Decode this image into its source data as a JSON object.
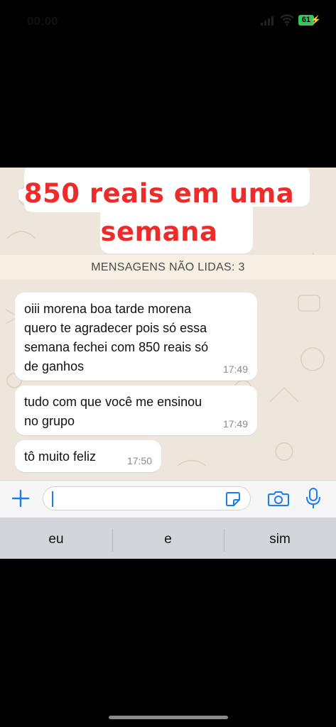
{
  "status_bar": {
    "time": "00:00",
    "battery": "61"
  },
  "title": {
    "line1": "850 reais em uma",
    "line2": "semana"
  },
  "unread_banner": "MENSAGENS NÃO LIDAS: 3",
  "messages": [
    {
      "lines": [
        "oiii morena boa tarde morena",
        "quero te agradecer pois só essa",
        "semana fechei com 850 reais só",
        "de ganhos"
      ],
      "time": "17:49"
    },
    {
      "lines": [
        "tudo com que você me ensinou",
        "no grupo"
      ],
      "time": "17:49"
    },
    {
      "lines": [
        "tô muito feliz"
      ],
      "time": "17:50"
    }
  ],
  "input": {
    "placeholder": ""
  },
  "suggestions": [
    "eu",
    "e",
    "sim"
  ],
  "colors": {
    "title_red": "#ee2b2b",
    "accent_blue": "#1a7cf5",
    "chat_bg": "#ede6dc",
    "battery_green": "#34c759"
  },
  "icons": [
    "plus-icon",
    "sticker-icon",
    "camera-icon",
    "microphone-icon",
    "signal-icon",
    "wifi-icon",
    "battery-icon"
  ]
}
